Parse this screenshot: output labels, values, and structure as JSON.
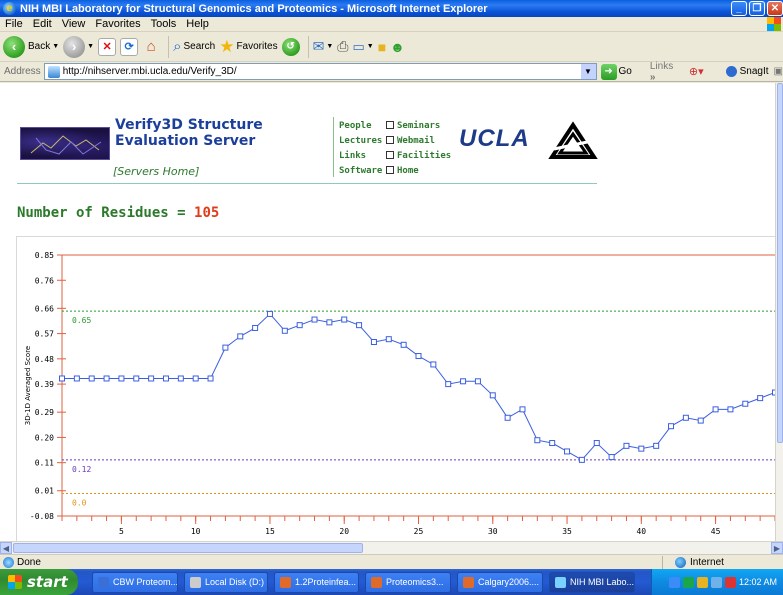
{
  "window": {
    "title": "NIH MBI Laboratory for Structural Genomics and Proteomics - Microsoft Internet Explorer"
  },
  "menu": [
    "File",
    "Edit",
    "View",
    "Favorites",
    "Tools",
    "Help"
  ],
  "toolbar": {
    "back": "Back",
    "search": "Search",
    "favorites": "Favorites"
  },
  "address": {
    "label": "Address",
    "url": "http://nihserver.mbi.ucla.edu/Verify_3D/",
    "go": "Go",
    "links": "Links",
    "snagit": "SnagIt"
  },
  "page": {
    "title_line1": "Verify3D Structure",
    "title_line2": "Evaluation Server",
    "servers_home": "[Servers Home]",
    "nav_left": [
      "People",
      "Lectures",
      "Links",
      "Software"
    ],
    "nav_right": [
      "Seminars",
      "Webmail",
      "Facilities",
      "Home"
    ],
    "ucla": "UCLA",
    "residues_label": "Number of Residues =",
    "residues_value": "105"
  },
  "chart_data": {
    "type": "line",
    "ylabel": "3D-1D Averaged Score",
    "xlabel": "",
    "y_ticks": [
      "0.85",
      "0.76",
      "0.66",
      "0.57",
      "0.48",
      "0.39",
      "0.29",
      "0.20",
      "0.11",
      "0.01",
      "-0.08"
    ],
    "y_tick_values": [
      0.85,
      0.76,
      0.66,
      0.57,
      0.48,
      0.39,
      0.29,
      0.2,
      0.11,
      0.01,
      -0.08
    ],
    "x_ticks": [
      "5",
      "10",
      "15",
      "20",
      "25",
      "30",
      "35",
      "40",
      "45"
    ],
    "x_tick_values": [
      5,
      10,
      15,
      20,
      25,
      30,
      35,
      40,
      45
    ],
    "ylim": [
      -0.08,
      0.85
    ],
    "xlim": [
      1,
      49
    ],
    "reference_lines": [
      {
        "value": 0.65,
        "label": "0.65",
        "color": "#2a9a2a"
      },
      {
        "value": 0.12,
        "label": "0.12",
        "color": "#6a3ab8"
      },
      {
        "value": 0.0,
        "label": "0.0",
        "color": "#e0941a"
      }
    ],
    "series": [
      {
        "color": "#3b5fe0",
        "x": [
          1,
          2,
          3,
          4,
          5,
          6,
          7,
          8,
          9,
          10,
          11,
          12,
          13,
          14,
          15,
          16,
          17,
          18,
          19,
          20,
          21,
          22,
          23,
          24,
          25,
          26,
          27,
          28,
          29,
          30,
          31,
          32,
          33,
          34,
          35,
          36,
          37,
          38,
          39,
          40,
          41,
          42,
          43,
          44,
          45,
          46,
          47,
          48,
          49
        ],
        "y": [
          0.41,
          0.41,
          0.41,
          0.41,
          0.41,
          0.41,
          0.41,
          0.41,
          0.41,
          0.41,
          0.41,
          0.52,
          0.56,
          0.59,
          0.64,
          0.58,
          0.6,
          0.62,
          0.61,
          0.62,
          0.6,
          0.54,
          0.55,
          0.53,
          0.49,
          0.46,
          0.39,
          0.4,
          0.4,
          0.35,
          0.27,
          0.3,
          0.19,
          0.18,
          0.15,
          0.12,
          0.18,
          0.13,
          0.17,
          0.16,
          0.17,
          0.24,
          0.27,
          0.26,
          0.3,
          0.3,
          0.32,
          0.34,
          0.36
        ]
      }
    ],
    "grid": false,
    "background": "#ffffff",
    "axis_color": "#e06040"
  },
  "status": {
    "left": "Done",
    "zone": "Internet"
  },
  "taskbar": {
    "start": "start",
    "tasks": [
      "CBW Proteom...",
      "Local Disk (D:)",
      "1.2Proteinfea...",
      "Proteomics3...",
      "Calgary2006....",
      "NIH MBI Labo..."
    ],
    "clock": "12:02 AM"
  }
}
